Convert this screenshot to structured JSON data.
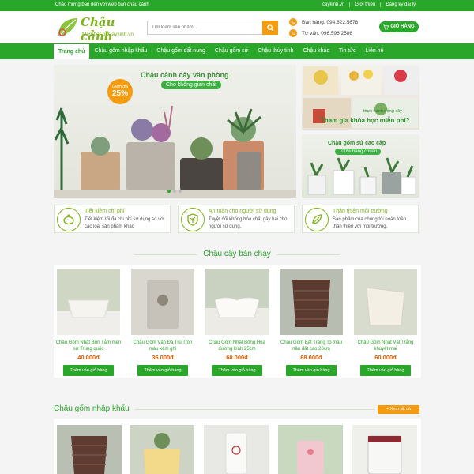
{
  "topbar": {
    "welcome": "Chào mừng bạn đến với web bán chậu cảnh",
    "links": [
      "caykinh.vn",
      "Giới thiệu",
      "Đăng ký đại lý"
    ]
  },
  "logo": {
    "brand": "Chậu cảnh",
    "tagline": "Member of Cayxinh.vn"
  },
  "search": {
    "placeholder": "Tìm kiếm sản phẩm..."
  },
  "contact": {
    "sales": "Bán hàng: 094.822.5678",
    "support": "Tư vấn: 096.596.2586"
  },
  "cart": {
    "label": "GIỎ HÀNG"
  },
  "nav": {
    "items": [
      "Trang chủ",
      "Chậu gốm nhập khẩu",
      "Chậu gốm đất nung",
      "Chậu gốm sứ",
      "Chậu thủy tinh",
      "Chậu khác",
      "Tin tức",
      "Liên hệ"
    ],
    "active_index": 0
  },
  "hero": {
    "title": "Chậu cảnh cây văn phòng",
    "subtitle": "Cho không gian chất",
    "badge_label": "Giảm giá",
    "badge_value": "25%"
  },
  "side_banners": [
    {
      "line1": "thực hành trồng cây",
      "line2": "Tham gia khóa học miễn phí?"
    },
    {
      "line1": "Chậu gốm sứ cao cấp",
      "line2": "100% hàng chuẩn"
    }
  ],
  "features": [
    {
      "title": "Tiết kiệm chi phí",
      "desc": "Tiết kiệm tối đa chi phí sử dụng so với các loại sản phẩm khác"
    },
    {
      "title": "An toàn cho người sử dụng",
      "desc": "Tuyệt đối không hóa chất gây hại cho người sử dụng."
    },
    {
      "title": "Thân thiện môi trường",
      "desc": "Sản phẩm của chúng tôi hoàn toàn thân thiện với môi trường."
    }
  ],
  "bestsellers": {
    "title": "Chậu cây bán chạy",
    "button_label": "Thêm vào giỏ hàng",
    "products": [
      {
        "name": "Chậu Gốm Nhật Bồn Tắm men sứ Trung quốc",
        "price": "40.000đ"
      },
      {
        "name": "Chậu Gốm Vân Đá Trụ Tròn màu xám ghi",
        "price": "35.000đ"
      },
      {
        "name": "Chậu Gốm Nhật Bông Hoa đường kính 25cm",
        "price": "60.000đ"
      },
      {
        "name": "Chậu Gốm Bát Tràng To màu nâu đất cao 20cm",
        "price": "68.000đ"
      },
      {
        "name": "Chậu Gốm Nhật Vát Trắng khuyết mai",
        "price": "60.000đ"
      }
    ]
  },
  "imported": {
    "title": "Chậu gốm nhập khẩu",
    "view_all": "+ Xem tất cả"
  },
  "colors": {
    "primary": "#2aa62a",
    "accent": "#f39c12",
    "price": "#e05a00"
  }
}
